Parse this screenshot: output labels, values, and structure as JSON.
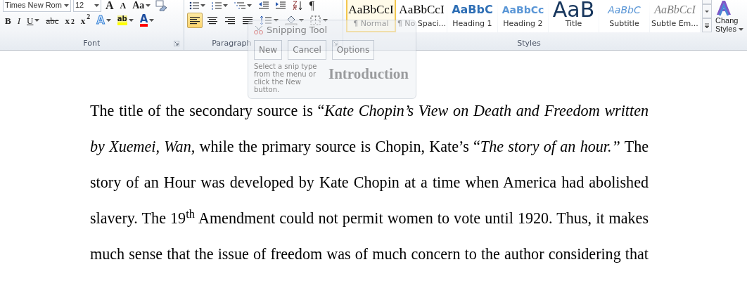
{
  "ribbon": {
    "font": {
      "label": "Font",
      "font_name": "Times New Rom",
      "font_size": "12",
      "top_buttons": [
        {
          "label": "A",
          "kind": "grow"
        },
        {
          "label": "A",
          "kind": "shrink"
        },
        {
          "label": "Aa",
          "kind": "case"
        }
      ],
      "format_buttons": [
        {
          "label": "B",
          "kind": "bold"
        },
        {
          "label": "I",
          "kind": "italic"
        },
        {
          "label": "U",
          "kind": "underline"
        },
        {
          "label": "abc",
          "kind": "strike"
        },
        {
          "label": "x$_{2}$",
          "kind": "sub"
        },
        {
          "label": "x$^{2}$",
          "kind": "sup"
        }
      ],
      "effect_buttons": [
        {
          "label": "A",
          "kind": "effects"
        },
        {
          "label": "ab",
          "kind": "highlight"
        },
        {
          "label": "A",
          "kind": "color"
        }
      ]
    },
    "paragraph": {
      "label": "Paragraph",
      "pilcrow": "¶",
      "alignments": [
        {
          "kind": "left",
          "selected": true
        },
        {
          "kind": "center",
          "selected": false
        },
        {
          "kind": "right",
          "selected": false
        },
        {
          "kind": "justify",
          "selected": false
        }
      ]
    },
    "styles": {
      "label": "Styles",
      "change_styles": [
        "Chang",
        "Styles"
      ],
      "items": [
        {
          "sample": "AaBbCcI",
          "label": "¶ Normal",
          "kind": "normal",
          "selected": true
        },
        {
          "sample": "AaBbCcI",
          "label": "¶ No Spaci...",
          "kind": "normal",
          "selected": false
        },
        {
          "sample": "AaBbC",
          "label": "Heading 1",
          "kind": "heading1",
          "selected": false
        },
        {
          "sample": "AaBbCc",
          "label": "Heading 2",
          "kind": "heading2",
          "selected": false
        },
        {
          "sample": "AaB",
          "label": "Title",
          "kind": "title",
          "selected": false
        },
        {
          "sample": "AaBbC",
          "label": "Subtitle",
          "kind": "subtitle",
          "selected": false
        },
        {
          "sample": "AaBbCcI",
          "label": "Subtle Em...",
          "kind": "emphasis",
          "selected": false
        }
      ]
    }
  },
  "snipping_tool": {
    "title": "Snipping Tool",
    "buttons": [
      "New",
      "Cancel",
      "Options"
    ],
    "message": "Select a snip type from the menu or click the New button."
  },
  "document": {
    "heading": "Introduction",
    "paragraph": "The title of the secondary source is “*Kate Chopin’s View on Death and Freedom written by Xuemei, Wan,* while the primary source is Chopin, Kate’s “*The story of an hour.”* The story of an Hour was developed by Kate Chopin at a time when America had abolished slavery. The 19$^{th}$ Amendment could not permit women to vote until 1920. Thus, it makes much sense that the issue of freedom was of much concern to the author considering that"
  }
}
